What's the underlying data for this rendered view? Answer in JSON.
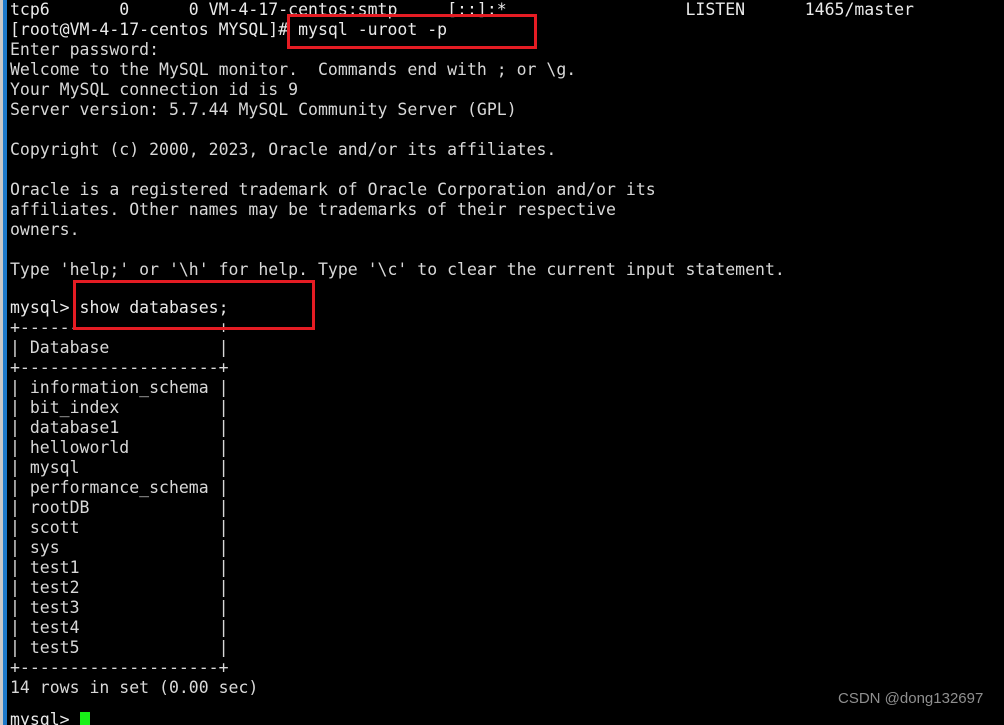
{
  "window": {
    "background_color": "#000000",
    "text_color": "#d8d8d8",
    "accent_color": "#e51c23",
    "scrollbar_color": "#1e79c8",
    "cursor_color": "#18f018"
  },
  "terminal": {
    "netstat_line": {
      "proto": "tcp6",
      "recv_q": "0",
      "send_q": "0",
      "local_address": "VM-4-17-centos:smtp",
      "foreign_address": "[::]:*",
      "state": "LISTEN",
      "pid_program": "1465/master",
      "full_text": "tcp6       0      0 VM-4-17-centos:smtp     [::]:*                  LISTEN      1465/master"
    },
    "shell_prompt": "[root@VM-4-17-centos MYSQL]# ",
    "shell_command": "mysql -uroot -p",
    "lines": [
      "Enter password:",
      "Welcome to the MySQL monitor.  Commands end with ; or \\g.",
      "Your MySQL connection id is 9",
      "Server version: 5.7.44 MySQL Community Server (GPL)",
      "",
      "Copyright (c) 2000, 2023, Oracle and/or its affiliates.",
      "",
      "Oracle is a registered trademark of Oracle Corporation and/or its",
      "affiliates. Other names may be trademarks of their respective",
      "owners.",
      "",
      "Type 'help;' or '\\h' for help. Type '\\c' to clear the current input statement.",
      ""
    ],
    "mysql_prompt": "mysql> ",
    "mysql_command": "show databases;",
    "result_table": {
      "top_border": "+--------------------+",
      "header": "| Database           |",
      "separator": "+--------------------+",
      "bottom_border": "+--------------------+",
      "rows": [
        "| information_schema |",
        "| bit_index          |",
        "| database1          |",
        "| helloworld         |",
        "| mysql              |",
        "| performance_schema |",
        "| rootDB             |",
        "| scott              |",
        "| sys                |",
        "| test1              |",
        "| test2              |",
        "| test3              |",
        "| test4              |",
        "| test5              |"
      ],
      "column_name": "Database",
      "row_count": 14
    },
    "result_status": "14 rows in set (0.00 sec)",
    "trailing_prompt": "mysql> "
  },
  "annotations": {
    "box_command_label": "mysql -uroot -p",
    "box_query_label": "show databases;"
  },
  "watermark": {
    "text": "CSDN @dong132697"
  }
}
